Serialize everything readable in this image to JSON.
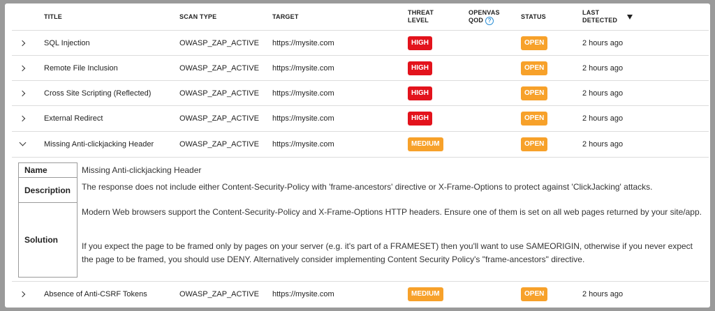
{
  "columns": {
    "title": "TITLE",
    "scan_type": "SCAN TYPE",
    "target": "TARGET",
    "threat_level_1": "THREAT",
    "threat_level_2": "LEVEL",
    "qod_1": "OPENVAS",
    "qod_2": "QOD",
    "qod_help": "?",
    "status": "STATUS",
    "last_1": "LAST",
    "last_2": "DETECTED"
  },
  "rows": [
    {
      "title": "SQL Injection",
      "scan_type": "OWASP_ZAP_ACTIVE",
      "target": "https://mysite.com",
      "threat": "HIGH",
      "status": "OPEN",
      "last": "2 hours ago"
    },
    {
      "title": "Remote File Inclusion",
      "scan_type": "OWASP_ZAP_ACTIVE",
      "target": "https://mysite.com",
      "threat": "HIGH",
      "status": "OPEN",
      "last": "2 hours ago"
    },
    {
      "title": "Cross Site Scripting (Reflected)",
      "scan_type": "OWASP_ZAP_ACTIVE",
      "target": "https://mysite.com",
      "threat": "HIGH",
      "status": "OPEN",
      "last": "2 hours ago"
    },
    {
      "title": "External Redirect",
      "scan_type": "OWASP_ZAP_ACTIVE",
      "target": "https://mysite.com",
      "threat": "HIGH",
      "status": "OPEN",
      "last": "2 hours ago"
    },
    {
      "title": "Missing Anti-clickjacking Header",
      "scan_type": "OWASP_ZAP_ACTIVE",
      "target": "https://mysite.com",
      "threat": "MEDIUM",
      "status": "OPEN",
      "last": "2 hours ago"
    },
    {
      "title": "Absence of Anti-CSRF Tokens",
      "scan_type": "OWASP_ZAP_ACTIVE",
      "target": "https://mysite.com",
      "threat": "MEDIUM",
      "status": "OPEN",
      "last": "2 hours ago"
    }
  ],
  "detail": {
    "name_label": "Name",
    "name_value": "Missing Anti-clickjacking Header",
    "description_label": "Description",
    "description_value": "The response does not include either Content-Security-Policy with 'frame-ancestors' directive or X-Frame-Options to protect against 'ClickJacking' attacks.",
    "solution_label": "Solution",
    "solution_p1": "Modern Web browsers support the Content-Security-Policy and X-Frame-Options HTTP headers. Ensure one of them is set on all web pages returned by your site/app.",
    "solution_p2": "If you expect the page to be framed only by pages on your server (e.g. it's part of a FRAMESET) then you'll want to use SAMEORIGIN, otherwise if you never expect the page to be framed, you should use DENY. Alternatively consider implementing Content Security Policy's \"frame-ancestors\" directive."
  },
  "colors": {
    "high": "#e3131c",
    "medium": "#f7a12a",
    "open": "#f7a12a",
    "help": "#2b8fd6"
  },
  "icons": {
    "collapsed": "chevron-right-icon",
    "expanded": "chevron-down-icon",
    "sort": "sort-desc-icon",
    "help": "help-icon"
  }
}
